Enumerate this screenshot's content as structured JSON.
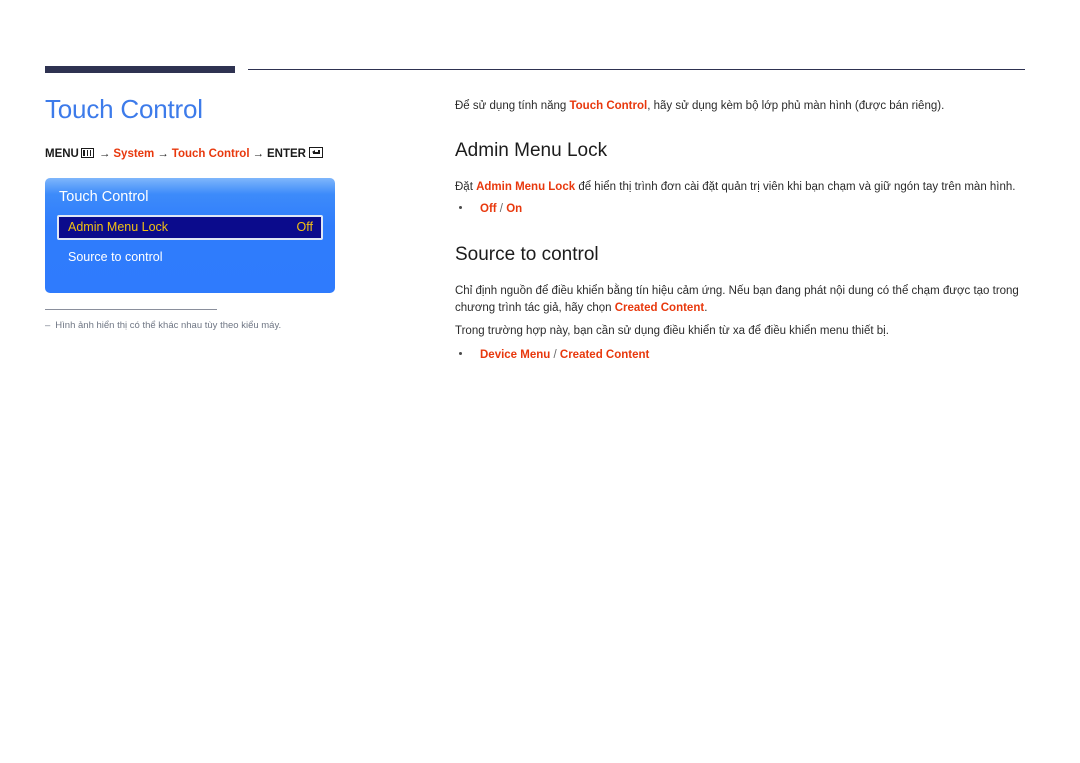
{
  "page": {
    "title": "Touch Control",
    "accent_blue": "#3d7bea",
    "accent_red": "#e8380d",
    "rule_color": "#2e3251"
  },
  "breadcrumb": {
    "menu_label": "MENU",
    "menu_icon": "menu-grid-icon",
    "arrow": "→",
    "item_system": "System",
    "item_touch_control": "Touch Control",
    "enter_label": "ENTER",
    "enter_icon": "enter-key-icon"
  },
  "osd": {
    "title": "Touch Control",
    "rows": [
      {
        "label": "Admin Menu Lock",
        "value": "Off",
        "selected": true
      },
      {
        "label": "Source to control",
        "value": "",
        "selected": false
      }
    ],
    "highlight_bg": "#0b0b8c",
    "highlight_text": "#f2c013"
  },
  "footnote": {
    "dash": "–",
    "text": "Hình ảnh hiển thị có thể khác nhau tùy theo kiểu máy."
  },
  "content": {
    "intro": {
      "before": "Để sử dụng tính năng ",
      "highlight": "Touch Control",
      "after": ", hãy sử dụng kèm bộ lớp phủ màn hình (được bán riêng)."
    },
    "admin_menu_lock": {
      "heading": "Admin Menu Lock",
      "para_before": "Đặt ",
      "para_highlight": "Admin Menu Lock",
      "para_after": " để hiển thị trình đơn cài đặt quản trị viên khi bạn chạm và giữ ngón tay trên màn hình.",
      "option_1": "Off",
      "option_separator": "/",
      "option_2": "On"
    },
    "source_to_control": {
      "heading": "Source to control",
      "para1_before": "Chỉ định nguồn để điều khiển bằng tín hiệu cảm ứng. Nếu bạn đang phát nội dung có thể chạm được tạo trong chương trình tác giả, hãy chọn ",
      "para1_highlight": "Created Content",
      "para1_after": ".",
      "para2": "Trong trường hợp này, bạn cần sử dụng điều khiển từ xa để điều khiển menu thiết bị.",
      "option_1": "Device Menu",
      "option_separator": "/",
      "option_2": "Created Content"
    }
  }
}
